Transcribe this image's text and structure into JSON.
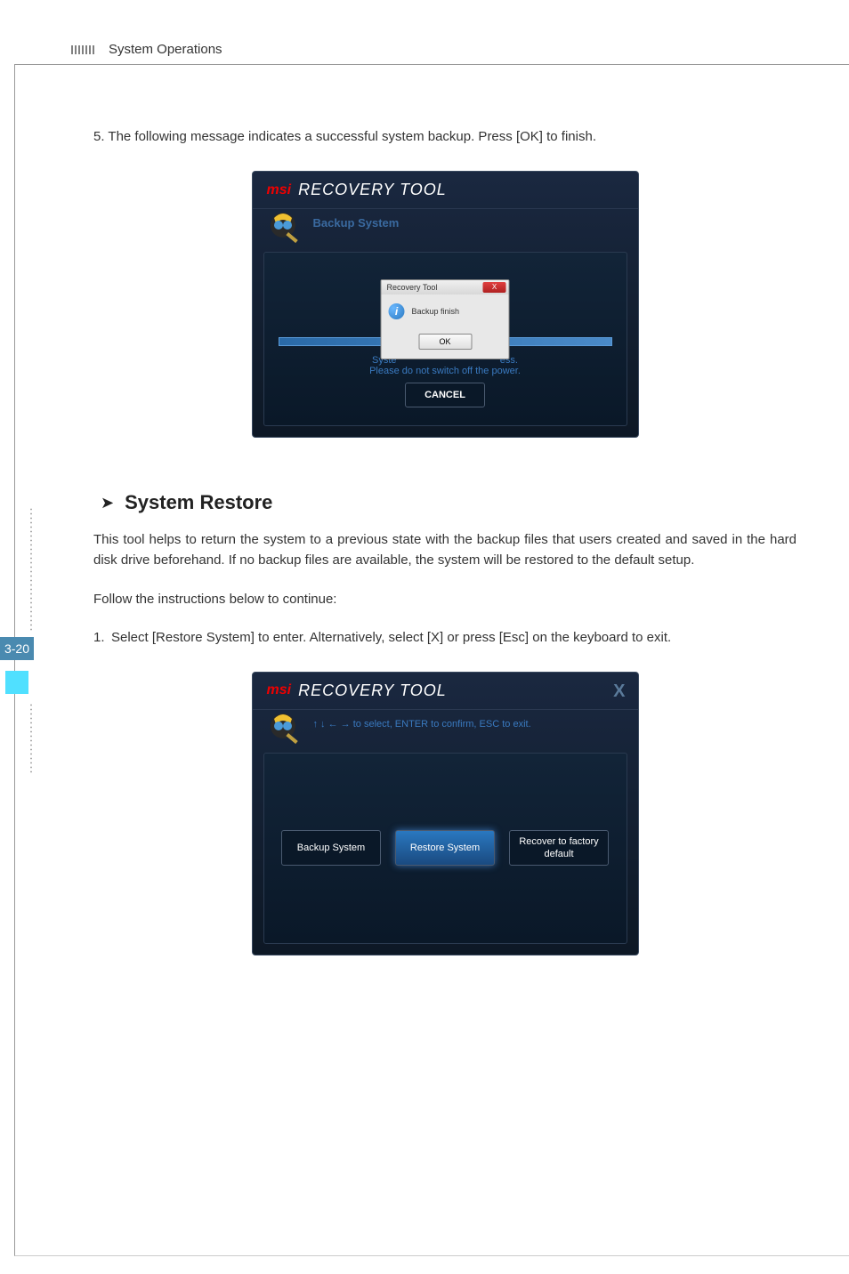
{
  "header": {
    "title": "System Operations"
  },
  "page_number": "3-20",
  "step5": "5. The following message indicates a successful system backup. Press [OK] to finish.",
  "screenshot1": {
    "brand": "msi",
    "logo_text": "RECOVERY TOOL",
    "subtitle": "Backup System",
    "dialog": {
      "title": "Recovery Tool",
      "close": "X",
      "message": "Backup finish",
      "ok": "OK"
    },
    "status_line1_a": "Syste",
    "status_line1_b": "ess.",
    "status_line2_a": "Please do ",
    "status_line2_b": "not switch off the",
    "status_line2_c": " power.",
    "cancel": "CANCEL"
  },
  "section": {
    "title": "System Restore",
    "paragraph": "This tool helps to return the system to a previous state with the backup files that  users created and saved in the hard disk drive beforehand. If no backup files are available, the system will be restored to the default setup.",
    "instructions": "Follow the instructions below to continue:",
    "step1_num": "1.",
    "step1_a": "Select [Restore System] to enter. ",
    "step1_b": "Alternatively, select [X] or press [Esc] on the keyboard to exit."
  },
  "screenshot2": {
    "brand": "msi",
    "logo_text": "RECOVERY TOOL",
    "close": "X",
    "nav_hint": "↑ ↓ ← → to select, ENTER to confirm, ESC to exit.",
    "opt1": "Backup System",
    "opt2": "Restore System",
    "opt3": "Recover to factory default"
  }
}
